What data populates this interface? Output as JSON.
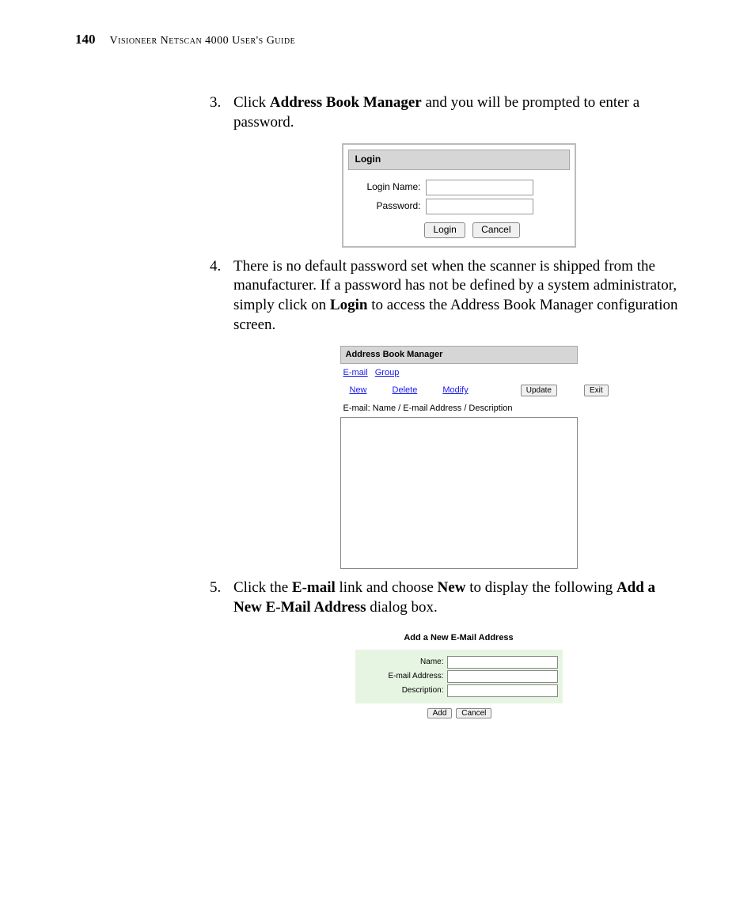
{
  "header": {
    "page_number": "140",
    "title": "Visioneer Netscan 4000 User's Guide"
  },
  "steps": {
    "s3": {
      "num": "3.",
      "t1": "Click ",
      "b1": "Address Book Manager",
      "t2": " and you will be prompted to enter a password."
    },
    "s4": {
      "num": "4.",
      "t1": "There is no default password set when the scanner is shipped from the manufacturer. If a password has not be defined by a system administrator, simply click on ",
      "b1": "Login",
      "t2": " to access the Address Book Manager configuration screen."
    },
    "s5": {
      "num": "5.",
      "t1": "Click the ",
      "b1": "E-mail",
      "t2": " link and choose ",
      "b2": "New",
      "t3": " to display the following ",
      "b3": "Add a New E-Mail Address",
      "t4": " dialog box."
    }
  },
  "login_dialog": {
    "title": "Login",
    "login_name_label": "Login Name:",
    "password_label": "Password:",
    "login_btn": "Login",
    "cancel_btn": "Cancel"
  },
  "abm_panel": {
    "title": "Address Book Manager",
    "tab_email": "E-mail",
    "tab_group": "Group",
    "link_new": "New",
    "link_delete": "Delete",
    "link_modify": "Modify",
    "btn_update": "Update",
    "btn_exit": "Exit",
    "col_header": "E-mail: Name / E-mail Address / Description"
  },
  "add_email_dialog": {
    "title": "Add a New E-Mail Address",
    "name_label": "Name:",
    "email_label": "E-mail Address:",
    "desc_label": "Description:",
    "btn_add": "Add",
    "btn_cancel": "Cancel"
  }
}
